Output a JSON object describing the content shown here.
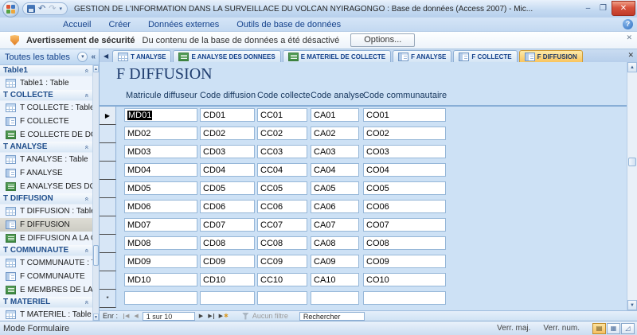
{
  "window": {
    "title": "GESTION DE L'INFORMATION DANS LA SURVEILLACE DU VOLCAN NYIRAGONGO : Base de données (Access 2007) - Mic..."
  },
  "glyphs": {
    "minimize": "–",
    "restore": "❐",
    "close": "✕",
    "help": "?",
    "undo": "↶",
    "redo": "↷",
    "qat_drop": "▾",
    "pane_drop": "▾",
    "pane_collapse": "«",
    "group_collapse": "«",
    "tab_scroll_left": "◀",
    "tab_close": "✕",
    "msg_close": "✕",
    "row_current": "▶",
    "row_new": "*",
    "star": "✱",
    "nav_first": "◀",
    "nav_prev": "◀",
    "nav_next": "▶",
    "nav_last": "▶",
    "nav_new": "▶",
    "scroll_up": "▲",
    "scroll_down": "▼",
    "view_form": "▤",
    "view_datasheet": "▦",
    "view_design": "◿"
  },
  "ribbon": {
    "tabs": [
      "Accueil",
      "Créer",
      "Données externes",
      "Outils de base de données"
    ]
  },
  "message_bar": {
    "label": "Avertissement de sécurité",
    "message": "Du contenu de la base de données a été désactivé",
    "options": "Options..."
  },
  "nav_pane": {
    "header": "Toutes les tables",
    "groups": [
      {
        "name": "Table1",
        "items": [
          {
            "label": "Table1 : Table",
            "icon": "table"
          }
        ]
      },
      {
        "name": "T COLLECTE",
        "items": [
          {
            "label": "T COLLECTE : Table",
            "icon": "table"
          },
          {
            "label": "F COLLECTE",
            "icon": "form"
          },
          {
            "label": "E COLLECTE DE DO...",
            "icon": "report"
          }
        ]
      },
      {
        "name": "T ANALYSE",
        "items": [
          {
            "label": "T ANALYSE : Table",
            "icon": "table"
          },
          {
            "label": "F ANALYSE",
            "icon": "form"
          },
          {
            "label": "E ANALYSE DES DO...",
            "icon": "report"
          }
        ]
      },
      {
        "name": "T DIFFUSION",
        "items": [
          {
            "label": "T DIFFUSION : Table",
            "icon": "table"
          },
          {
            "label": "F DIFFUSION",
            "icon": "form"
          },
          {
            "label": "E DIFFUSION A LA C...",
            "icon": "report"
          }
        ]
      },
      {
        "name": "T COMMUNAUTE",
        "items": [
          {
            "label": "T COMMUNAUTE : T...",
            "icon": "table"
          },
          {
            "label": "F COMMUNAUTE",
            "icon": "form"
          },
          {
            "label": "E MEMBRES DE LA C...",
            "icon": "report"
          }
        ]
      },
      {
        "name": "T MATERIEL",
        "items": [
          {
            "label": "T MATERIEL : Table",
            "icon": "table"
          }
        ]
      }
    ]
  },
  "tabs": [
    {
      "label": "T ANALYSE"
    },
    {
      "label": "E ANALYSE DES DONNEES"
    },
    {
      "label": "E MATERIEL DE COLLECTE"
    },
    {
      "label": "F ANALYSE"
    },
    {
      "label": "F COLLECTE"
    },
    {
      "label": "F DIFFUSION"
    }
  ],
  "form": {
    "title": "F DIFFUSION",
    "columns": [
      "Matricule diffuseur",
      "Code diffusion",
      "Code collecte",
      "Code analyse",
      "Code communautaire"
    ],
    "rows": [
      [
        "MD01",
        "CD01",
        "CC01",
        "CA01",
        "CO01"
      ],
      [
        "MD02",
        "CD02",
        "CC02",
        "CA02",
        "CO02"
      ],
      [
        "MD03",
        "CD03",
        "CC03",
        "CA03",
        "CO03"
      ],
      [
        "MD04",
        "CD04",
        "CC04",
        "CA04",
        "CO04"
      ],
      [
        "MD05",
        "CD05",
        "CC05",
        "CA05",
        "CO05"
      ],
      [
        "MD06",
        "CD06",
        "CC06",
        "CA06",
        "CO06"
      ],
      [
        "MD07",
        "CD07",
        "CC07",
        "CA07",
        "CO07"
      ],
      [
        "MD08",
        "CD08",
        "CC08",
        "CA08",
        "CO08"
      ],
      [
        "MD09",
        "CD09",
        "CC09",
        "CA09",
        "CO09"
      ],
      [
        "MD10",
        "CD10",
        "CC10",
        "CA10",
        "CO10"
      ]
    ]
  },
  "record_nav": {
    "label": "Enr :",
    "position": "1 sur 10",
    "filter": "Aucun filtre",
    "search": "Rechercher"
  },
  "status_bar": {
    "mode": "Mode Formulaire",
    "caps": "Verr. maj.",
    "num": "Verr. num."
  },
  "colors": {
    "active_tab": "#f9c45e",
    "titlebar": "#c3d9f1",
    "selection": "#000000"
  }
}
